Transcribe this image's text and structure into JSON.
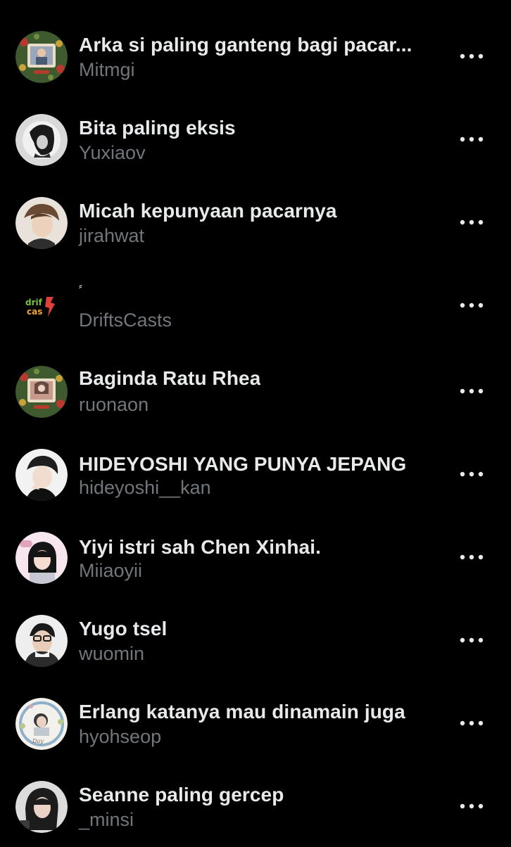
{
  "users": [
    {
      "display_name": "Arka si paling ganteng bagi pacar...",
      "handle": "Mitmgi",
      "avatar": "avatar-christmas-frame"
    },
    {
      "display_name": "Bita paling eksis",
      "handle": "Yuxiaov",
      "avatar": "avatar-portrait-grayscale"
    },
    {
      "display_name": "Micah kepunyaan pacarnya",
      "handle": "jirahwat",
      "avatar": "avatar-portrait-light"
    },
    {
      "display_name": "⸗",
      "handle": "DriftsCasts",
      "avatar": "avatar-drifts-casts-logo"
    },
    {
      "display_name": "Baginda Ratu Rhea",
      "handle": "ruonaon",
      "avatar": "avatar-christmas-frame"
    },
    {
      "display_name": "HIDEYOSHI YANG PUNYA JEPANG",
      "handle": "hideyoshi__kan",
      "avatar": "avatar-portrait-dark"
    },
    {
      "display_name": "Yiyi istri sah Chen Xinhai.",
      "handle": "Miiaoyii",
      "avatar": "avatar-portrait-pink"
    },
    {
      "display_name": "Yugo tsel",
      "handle": "wuomin",
      "avatar": "avatar-portrait-glasses"
    },
    {
      "display_name": "Erlang katanya mau dinamain juga",
      "handle": "hyohseop",
      "avatar": "avatar-wreath-frame"
    },
    {
      "display_name": "Seanne paling gercep",
      "handle": "_minsi",
      "avatar": "avatar-portrait-sketch"
    }
  ],
  "more_icon": "more-horizontal-icon",
  "colors": {
    "background": "#000000",
    "name_text": "#e7e9ea",
    "handle_text": "#71767b"
  }
}
